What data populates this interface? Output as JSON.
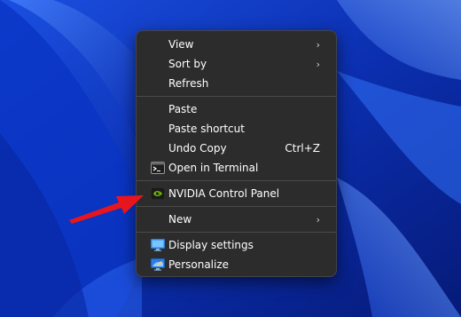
{
  "colors": {
    "menu_bg": "#2c2c2c",
    "menu_text": "#ffffff",
    "separator": "#4a4a4a",
    "wallpaper_base": "#0a2fa8",
    "annotation_arrow": "#e8161c"
  },
  "context_menu": {
    "groups": [
      [
        {
          "label": "View",
          "submenu": true
        },
        {
          "label": "Sort by",
          "submenu": true
        },
        {
          "label": "Refresh"
        }
      ],
      [
        {
          "label": "Paste"
        },
        {
          "label": "Paste shortcut"
        },
        {
          "label": "Undo Copy",
          "shortcut": "Ctrl+Z"
        },
        {
          "label": "Open in Terminal",
          "icon": "terminal-icon"
        }
      ],
      [
        {
          "label": "NVIDIA Control Panel",
          "icon": "nvidia-icon"
        }
      ],
      [
        {
          "label": "New",
          "submenu": true
        }
      ],
      [
        {
          "label": "Display settings",
          "icon": "display-settings-icon"
        },
        {
          "label": "Personalize",
          "icon": "personalize-icon"
        }
      ]
    ],
    "submenu_glyph": "›"
  }
}
